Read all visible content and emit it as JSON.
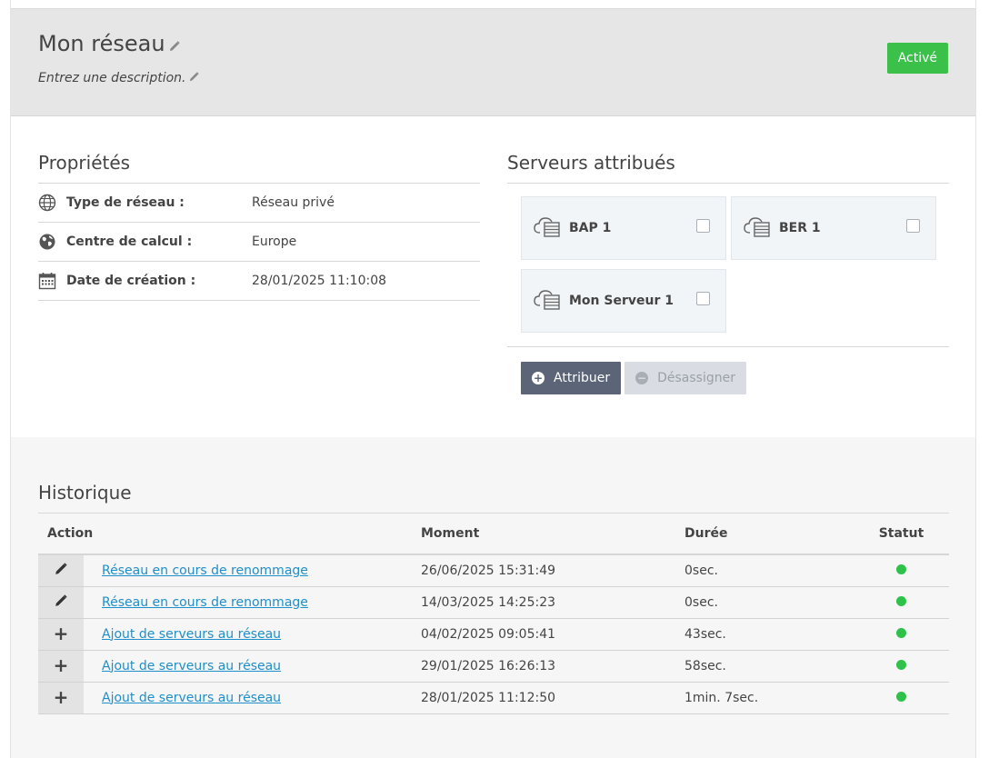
{
  "header": {
    "title": "Mon réseau",
    "description": "Entrez une description.",
    "status_label": "Activé",
    "status_color": "#3bc14a"
  },
  "properties": {
    "title": "Propriétés",
    "rows": [
      {
        "icon": "globe-icon",
        "label": "Type de réseau :",
        "value": "Réseau privé"
      },
      {
        "icon": "earth-icon",
        "label": "Centre de calcul :",
        "value": "Europe"
      },
      {
        "icon": "calendar-icon",
        "label": "Date de création :",
        "value": "28/01/2025 11:10:08"
      }
    ]
  },
  "servers": {
    "title": "Serveurs attribués",
    "items": [
      {
        "name": "BAP 1",
        "checked": false
      },
      {
        "name": "BER 1",
        "checked": false
      },
      {
        "name": "Mon Serveur 1",
        "checked": false
      }
    ],
    "assign_label": "Attribuer",
    "unassign_label": "Désassigner"
  },
  "history": {
    "title": "Historique",
    "columns": {
      "action": "Action",
      "moment": "Moment",
      "duree": "Durée",
      "statut": "Statut"
    },
    "rows": [
      {
        "icon": "pencil-icon",
        "action": "Réseau en cours de renommage",
        "moment": "26/06/2025 15:31:49",
        "duree": "0sec.",
        "status": "success"
      },
      {
        "icon": "pencil-icon",
        "action": "Réseau en cours de renommage",
        "moment": "14/03/2025 14:25:23",
        "duree": "0sec.",
        "status": "success"
      },
      {
        "icon": "plus-icon",
        "action": "Ajout de serveurs au réseau",
        "moment": "04/02/2025 09:05:41",
        "duree": "43sec.",
        "status": "success"
      },
      {
        "icon": "plus-icon",
        "action": "Ajout de serveurs au réseau",
        "moment": "29/01/2025 16:26:13",
        "duree": "58sec.",
        "status": "success"
      },
      {
        "icon": "plus-icon",
        "action": "Ajout de serveurs au réseau",
        "moment": "28/01/2025 11:12:50",
        "duree": "1min. 7sec.",
        "status": "success"
      }
    ],
    "status_color": "#2fc24a",
    "link_color": "#1f8fc9"
  }
}
